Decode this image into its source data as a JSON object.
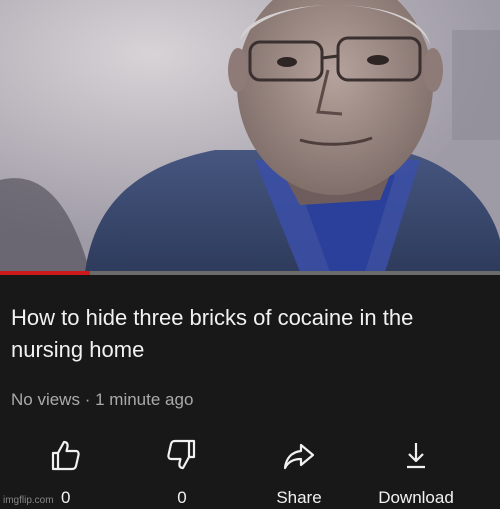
{
  "video": {
    "progress_fraction": 0.18
  },
  "info": {
    "title": "How to hide three bricks of cocaine in the nursing home",
    "views": "No views",
    "separator": "·",
    "time": "1 minute ago"
  },
  "actions": {
    "like_count": "0",
    "dislike_count": "0",
    "share_label": "Share",
    "download_label": "Download"
  },
  "watermark": "imgflip.com",
  "colors": {
    "background": "#181818",
    "progress_played": "#cc1a1a",
    "title_text": "#f1f1f1",
    "meta_text": "#aaaaaa"
  },
  "icons": {
    "like": "thumbs-up-icon",
    "dislike": "thumbs-down-icon",
    "share": "share-arrow-icon",
    "download": "download-arrow-icon"
  }
}
